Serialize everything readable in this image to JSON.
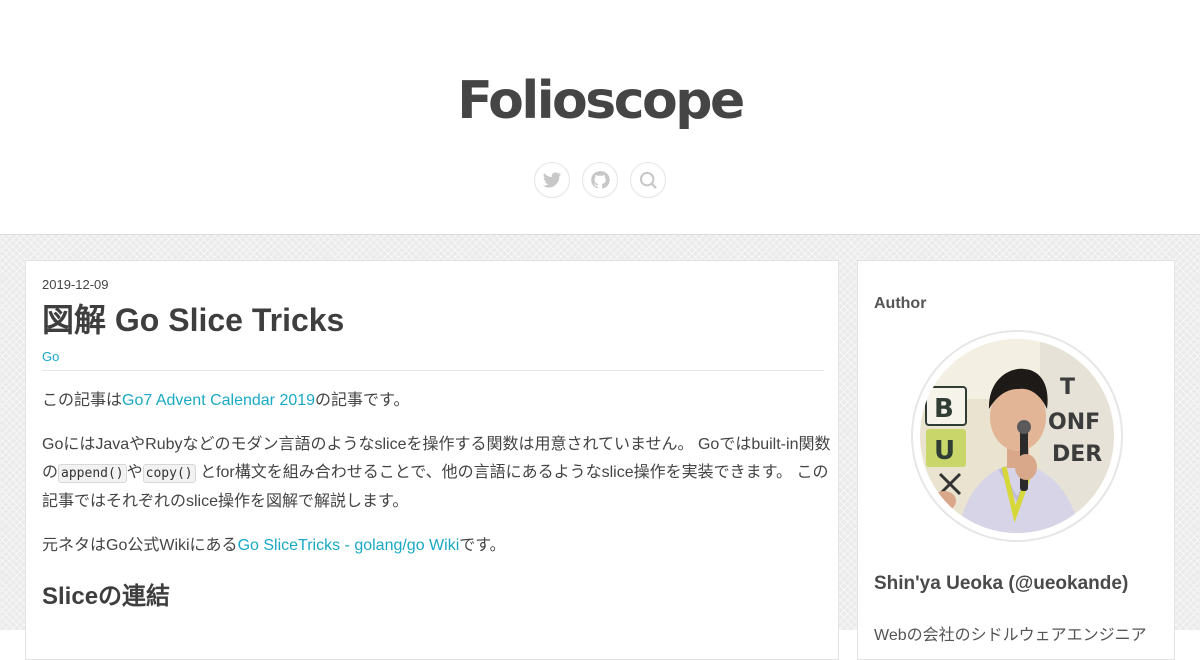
{
  "header": {
    "site_title": "Folioscope",
    "social": [
      {
        "icon": "twitter-icon"
      },
      {
        "icon": "github-icon"
      },
      {
        "icon": "search-icon"
      }
    ]
  },
  "article": {
    "date": "2019-12-09",
    "title": "図解 Go Slice Tricks",
    "category": "Go",
    "p1": {
      "pre": "この記事は",
      "link": "Go7 Advent Calendar 2019",
      "post": "の記事です。"
    },
    "p2": {
      "text1": "GoにはJavaやRubyなどのモダン言語のようなsliceを操作する関数は用意されていません。 Goではbuilt-in関数の",
      "code1": "append()",
      "text2": "や",
      "code2": "copy()",
      "text3": " とfor構文を組み合わせることで、他の言語にあるようなslice操作を実装できます。 この記事ではそれぞれのslice操作を図解で解説します。"
    },
    "p3": {
      "pre": "元ネタはGo公式Wikiにある",
      "link": "Go SliceTricks - golang/go Wiki",
      "post": "です。"
    },
    "section_heading": "Sliceの連結"
  },
  "sidebar": {
    "heading": "Author",
    "author_name": "Shin'ya Ueoka (@ueokande)",
    "bio": "Webの会社のシドルウェアエンジニア"
  },
  "colors": {
    "link": "#19a9c4",
    "title_text": "#454545",
    "band_background": "#ebebeb"
  }
}
